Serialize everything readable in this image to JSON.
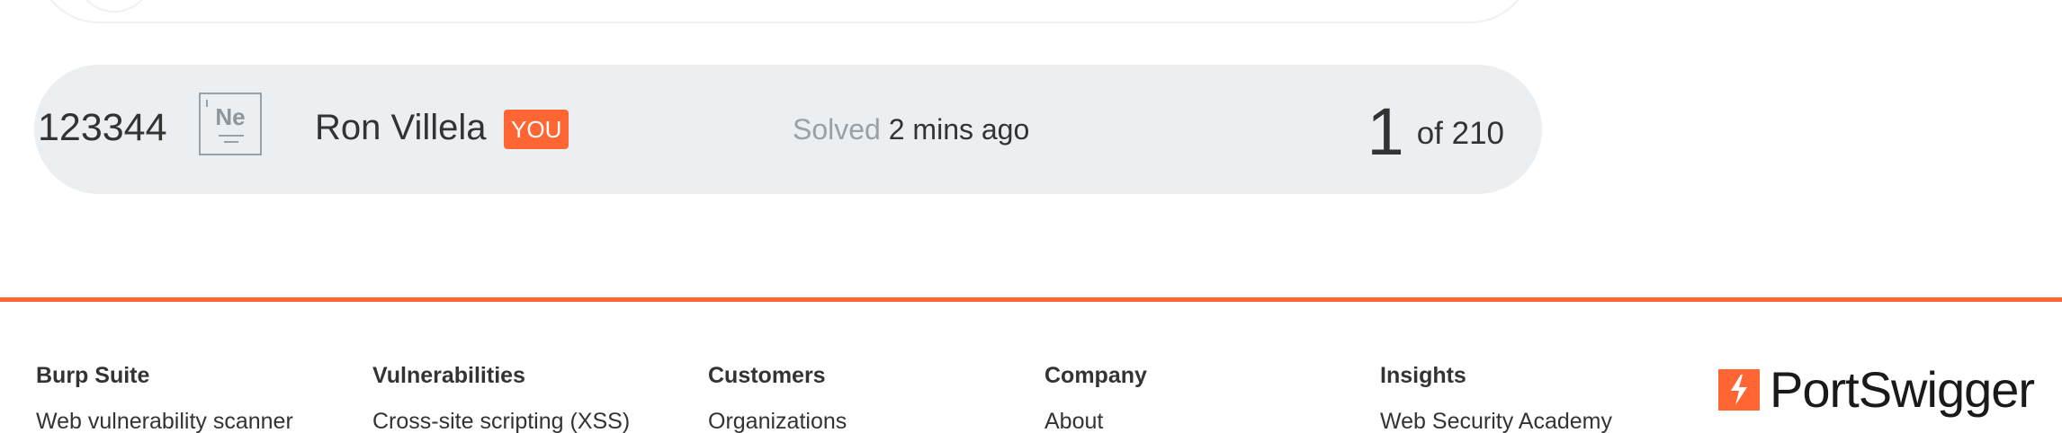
{
  "leaderboard": {
    "row": {
      "id": "123344",
      "element_symbol": "Ne",
      "name": "Ron Villela",
      "you_label": "YOU",
      "solved_label": "Solved",
      "solved_time": "2 mins ago",
      "position": "1",
      "total_text": "of 210"
    }
  },
  "footer": {
    "accent_color": "#ff6633",
    "columns": [
      {
        "heading": "Burp Suite",
        "first_link": "Web vulnerability scanner"
      },
      {
        "heading": "Vulnerabilities",
        "first_link": "Cross-site scripting (XSS)"
      },
      {
        "heading": "Customers",
        "first_link": "Organizations"
      },
      {
        "heading": "Company",
        "first_link": "About"
      },
      {
        "heading": "Insights",
        "first_link": "Web Security Academy"
      }
    ],
    "logo_text": "PortSwigger"
  }
}
